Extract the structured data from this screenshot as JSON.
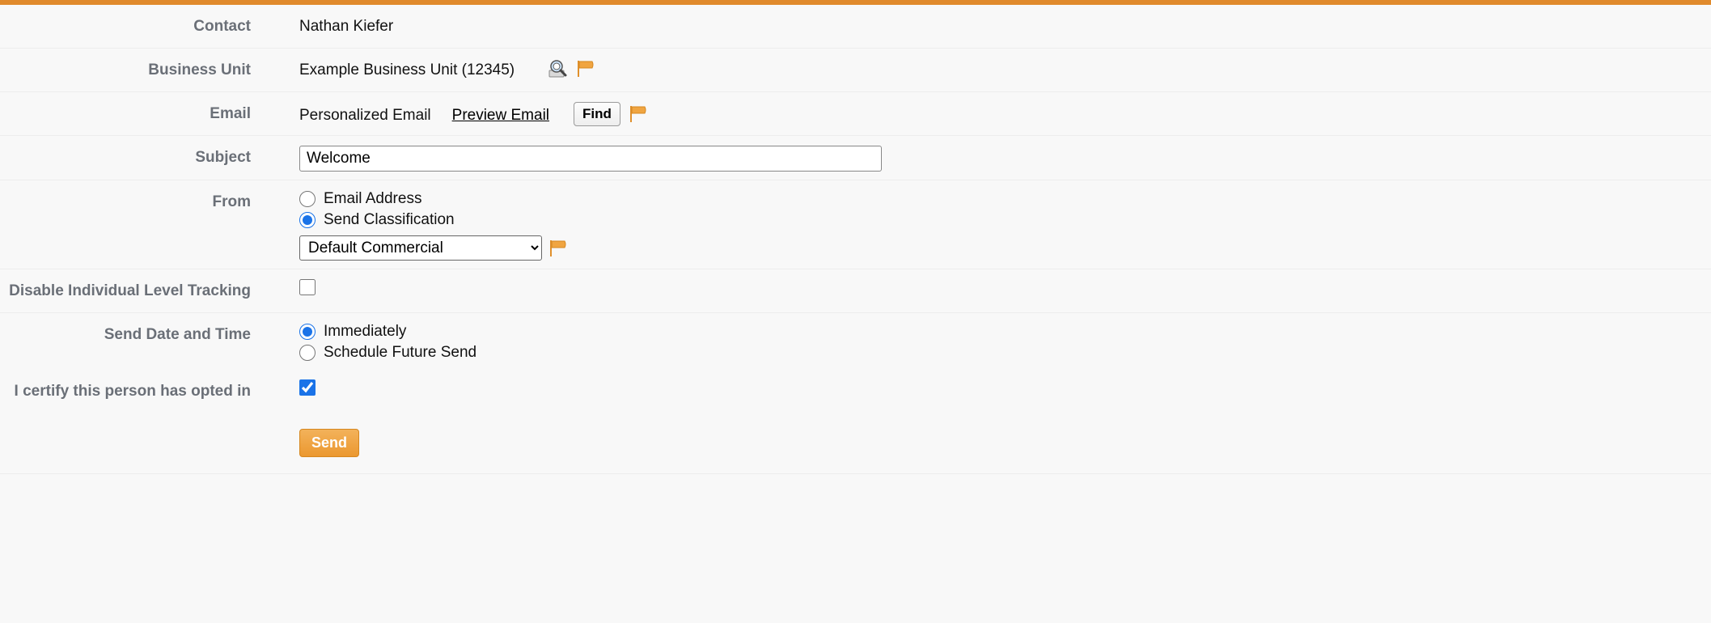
{
  "labels": {
    "contact": "Contact",
    "business_unit": "Business Unit",
    "email": "Email",
    "subject": "Subject",
    "from": "From",
    "disable_tracking": "Disable Individual Level Tracking",
    "send_date": "Send Date and Time",
    "certify": "I certify this person has opted in"
  },
  "contact": {
    "name": "Nathan Kiefer"
  },
  "business_unit": {
    "name": "Example Business Unit (12345)"
  },
  "email": {
    "type_label": "Personalized Email",
    "preview_link": "Preview Email",
    "find_label": "Find"
  },
  "subject": {
    "value": "Welcome"
  },
  "from": {
    "option_email": "Email Address",
    "option_classification": "Send Classification",
    "selected": "classification",
    "classification_value": "Default Commercial",
    "classification_options": [
      "Default Commercial"
    ]
  },
  "disable_tracking": {
    "checked": false
  },
  "send_date": {
    "option_immediate": "Immediately",
    "option_schedule": "Schedule Future Send",
    "selected": "immediate"
  },
  "certify": {
    "checked": true
  },
  "actions": {
    "send": "Send"
  },
  "icons": {
    "flag": "flag-icon",
    "search": "search-icon"
  },
  "colors": {
    "accent_orange": "#e08a2c",
    "label_grey": "#6a6f77"
  }
}
